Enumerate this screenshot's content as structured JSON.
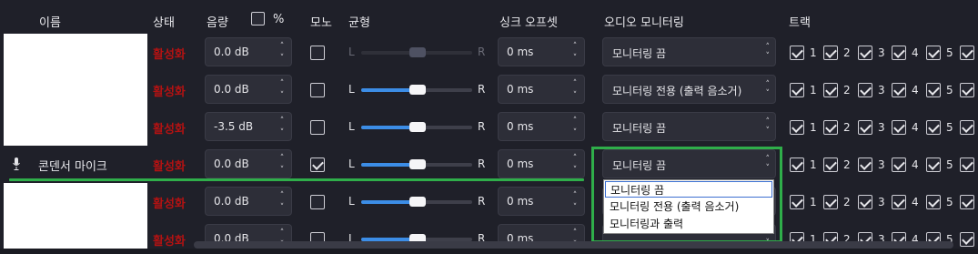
{
  "headers": {
    "name": "이름",
    "status": "상태",
    "volume": "음량",
    "percent": "%",
    "mono": "모노",
    "balance": "균형",
    "sync_offset": "싱크 오프셋",
    "audio_monitoring": "오디오 모니터링",
    "tracks": "트랙"
  },
  "rows": [
    {
      "name": "",
      "status": "활성화",
      "volume": "0.0 dB",
      "mono": false,
      "balance_l": "L",
      "balance_r": "R",
      "balance_value": 0.5,
      "balance_enabled": false,
      "sync": "0 ms",
      "monitoring": "모니터링 끔",
      "tracks": [
        "1",
        "2",
        "3",
        "4",
        "5"
      ]
    },
    {
      "name": "",
      "status": "활성화",
      "volume": "0.0 dB",
      "mono": false,
      "balance_l": "L",
      "balance_r": "R",
      "balance_value": 0.5,
      "balance_enabled": true,
      "sync": "0 ms",
      "monitoring": "모니터링 전용 (출력 음소거)",
      "tracks": [
        "1",
        "2",
        "3",
        "4",
        "5"
      ]
    },
    {
      "name": "",
      "status": "활성화",
      "volume": "-3.5 dB",
      "mono": false,
      "balance_l": "L",
      "balance_r": "R",
      "balance_value": 0.5,
      "balance_enabled": true,
      "sync": "0 ms",
      "monitoring": "모니터링 끔",
      "tracks": [
        "1",
        "2",
        "3",
        "4",
        "5"
      ]
    },
    {
      "name": "콘덴서 마이크",
      "status": "활성화",
      "volume": "0.0 dB",
      "mono": true,
      "balance_l": "L",
      "balance_r": "R",
      "balance_value": 0.5,
      "balance_enabled": true,
      "sync": "0 ms",
      "monitoring": "모니터링 끔",
      "tracks": [
        "1",
        "2",
        "3",
        "4",
        "5"
      ]
    },
    {
      "name": "",
      "status": "활성화",
      "volume": "0.0 dB",
      "mono": false,
      "balance_l": "L",
      "balance_r": "R",
      "balance_value": 0.5,
      "balance_enabled": true,
      "sync": "0 ms",
      "monitoring": "",
      "tracks": [
        "1",
        "2",
        "3",
        "4",
        "5"
      ]
    },
    {
      "name": "",
      "status": "활성화",
      "volume": "0.0 dB",
      "mono": false,
      "balance_l": "L",
      "balance_r": "R",
      "balance_value": 0.5,
      "balance_enabled": true,
      "sync": "0 ms",
      "monitoring": "",
      "tracks": [
        "1",
        "2",
        "3",
        "4",
        "5"
      ]
    }
  ],
  "dropdown": {
    "options": [
      "모니터링 끔",
      "모니터링 전용 (출력 음소거)",
      "모니터링과 출력"
    ],
    "selected": "모니터링 끔"
  },
  "icons": {
    "source": "microphone-icon",
    "spin_up": "chevron-up-icon",
    "spin_down": "chevron-down-icon",
    "checkbox": "checkmark-icon"
  },
  "colors": {
    "status_active": "#b31212",
    "highlight": "#2fae4a",
    "slider_fill": "#3c8de6"
  }
}
